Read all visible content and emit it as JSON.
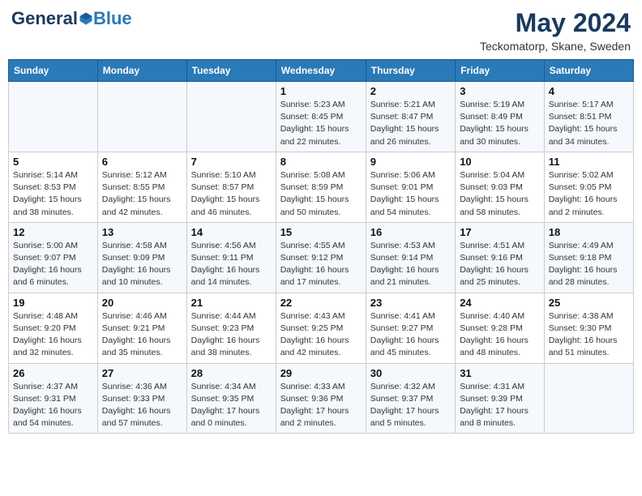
{
  "header": {
    "logo_general": "General",
    "logo_blue": "Blue",
    "month": "May 2024",
    "location": "Teckomatorp, Skane, Sweden"
  },
  "days_of_week": [
    "Sunday",
    "Monday",
    "Tuesday",
    "Wednesday",
    "Thursday",
    "Friday",
    "Saturday"
  ],
  "weeks": [
    {
      "row": 1,
      "days": [
        {
          "num": "",
          "info": ""
        },
        {
          "num": "",
          "info": ""
        },
        {
          "num": "",
          "info": ""
        },
        {
          "num": "1",
          "info": "Sunrise: 5:23 AM\nSunset: 8:45 PM\nDaylight: 15 hours\nand 22 minutes."
        },
        {
          "num": "2",
          "info": "Sunrise: 5:21 AM\nSunset: 8:47 PM\nDaylight: 15 hours\nand 26 minutes."
        },
        {
          "num": "3",
          "info": "Sunrise: 5:19 AM\nSunset: 8:49 PM\nDaylight: 15 hours\nand 30 minutes."
        },
        {
          "num": "4",
          "info": "Sunrise: 5:17 AM\nSunset: 8:51 PM\nDaylight: 15 hours\nand 34 minutes."
        }
      ]
    },
    {
      "row": 2,
      "days": [
        {
          "num": "5",
          "info": "Sunrise: 5:14 AM\nSunset: 8:53 PM\nDaylight: 15 hours\nand 38 minutes."
        },
        {
          "num": "6",
          "info": "Sunrise: 5:12 AM\nSunset: 8:55 PM\nDaylight: 15 hours\nand 42 minutes."
        },
        {
          "num": "7",
          "info": "Sunrise: 5:10 AM\nSunset: 8:57 PM\nDaylight: 15 hours\nand 46 minutes."
        },
        {
          "num": "8",
          "info": "Sunrise: 5:08 AM\nSunset: 8:59 PM\nDaylight: 15 hours\nand 50 minutes."
        },
        {
          "num": "9",
          "info": "Sunrise: 5:06 AM\nSunset: 9:01 PM\nDaylight: 15 hours\nand 54 minutes."
        },
        {
          "num": "10",
          "info": "Sunrise: 5:04 AM\nSunset: 9:03 PM\nDaylight: 15 hours\nand 58 minutes."
        },
        {
          "num": "11",
          "info": "Sunrise: 5:02 AM\nSunset: 9:05 PM\nDaylight: 16 hours\nand 2 minutes."
        }
      ]
    },
    {
      "row": 3,
      "days": [
        {
          "num": "12",
          "info": "Sunrise: 5:00 AM\nSunset: 9:07 PM\nDaylight: 16 hours\nand 6 minutes."
        },
        {
          "num": "13",
          "info": "Sunrise: 4:58 AM\nSunset: 9:09 PM\nDaylight: 16 hours\nand 10 minutes."
        },
        {
          "num": "14",
          "info": "Sunrise: 4:56 AM\nSunset: 9:11 PM\nDaylight: 16 hours\nand 14 minutes."
        },
        {
          "num": "15",
          "info": "Sunrise: 4:55 AM\nSunset: 9:12 PM\nDaylight: 16 hours\nand 17 minutes."
        },
        {
          "num": "16",
          "info": "Sunrise: 4:53 AM\nSunset: 9:14 PM\nDaylight: 16 hours\nand 21 minutes."
        },
        {
          "num": "17",
          "info": "Sunrise: 4:51 AM\nSunset: 9:16 PM\nDaylight: 16 hours\nand 25 minutes."
        },
        {
          "num": "18",
          "info": "Sunrise: 4:49 AM\nSunset: 9:18 PM\nDaylight: 16 hours\nand 28 minutes."
        }
      ]
    },
    {
      "row": 4,
      "days": [
        {
          "num": "19",
          "info": "Sunrise: 4:48 AM\nSunset: 9:20 PM\nDaylight: 16 hours\nand 32 minutes."
        },
        {
          "num": "20",
          "info": "Sunrise: 4:46 AM\nSunset: 9:21 PM\nDaylight: 16 hours\nand 35 minutes."
        },
        {
          "num": "21",
          "info": "Sunrise: 4:44 AM\nSunset: 9:23 PM\nDaylight: 16 hours\nand 38 minutes."
        },
        {
          "num": "22",
          "info": "Sunrise: 4:43 AM\nSunset: 9:25 PM\nDaylight: 16 hours\nand 42 minutes."
        },
        {
          "num": "23",
          "info": "Sunrise: 4:41 AM\nSunset: 9:27 PM\nDaylight: 16 hours\nand 45 minutes."
        },
        {
          "num": "24",
          "info": "Sunrise: 4:40 AM\nSunset: 9:28 PM\nDaylight: 16 hours\nand 48 minutes."
        },
        {
          "num": "25",
          "info": "Sunrise: 4:38 AM\nSunset: 9:30 PM\nDaylight: 16 hours\nand 51 minutes."
        }
      ]
    },
    {
      "row": 5,
      "days": [
        {
          "num": "26",
          "info": "Sunrise: 4:37 AM\nSunset: 9:31 PM\nDaylight: 16 hours\nand 54 minutes."
        },
        {
          "num": "27",
          "info": "Sunrise: 4:36 AM\nSunset: 9:33 PM\nDaylight: 16 hours\nand 57 minutes."
        },
        {
          "num": "28",
          "info": "Sunrise: 4:34 AM\nSunset: 9:35 PM\nDaylight: 17 hours\nand 0 minutes."
        },
        {
          "num": "29",
          "info": "Sunrise: 4:33 AM\nSunset: 9:36 PM\nDaylight: 17 hours\nand 2 minutes."
        },
        {
          "num": "30",
          "info": "Sunrise: 4:32 AM\nSunset: 9:37 PM\nDaylight: 17 hours\nand 5 minutes."
        },
        {
          "num": "31",
          "info": "Sunrise: 4:31 AM\nSunset: 9:39 PM\nDaylight: 17 hours\nand 8 minutes."
        },
        {
          "num": "",
          "info": ""
        }
      ]
    }
  ]
}
